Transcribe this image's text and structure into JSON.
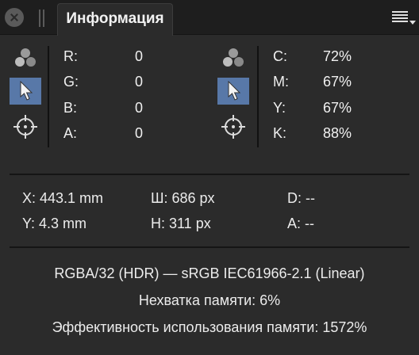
{
  "panel": {
    "tab_title": "Информация"
  },
  "rgb": [
    {
      "label": "R:",
      "value": "0"
    },
    {
      "label": "G:",
      "value": "0"
    },
    {
      "label": "B:",
      "value": "0"
    },
    {
      "label": "A:",
      "value": "0"
    }
  ],
  "cmyk": [
    {
      "label": "C:",
      "value": "72%"
    },
    {
      "label": "M:",
      "value": "67%"
    },
    {
      "label": "Y:",
      "value": "67%"
    },
    {
      "label": "K:",
      "value": "88%"
    }
  ],
  "measurements": {
    "x": "X: 443.1 mm",
    "y": "Y: 4.3 mm",
    "width": "Ш: 686 px",
    "height": "H: 311 px",
    "d": "D: --",
    "a": "A: --"
  },
  "document_info": {
    "format": "RGBA/32 (HDR) — sRGB IEC61966-2.1 (Linear)",
    "memory_shortage": "Нехватка памяти: 6%",
    "memory_efficiency": "Эффективность использования памяти: 1572%"
  },
  "colors": {
    "panel_bg": "#2b2b2b",
    "tabbar_bg": "#1e1e1e",
    "picker_active": "#5878a8"
  },
  "icons": [
    "close-icon",
    "grip-icon",
    "menu-icon",
    "color-circles-icon",
    "pointer-icon",
    "crosshair-icon"
  ]
}
